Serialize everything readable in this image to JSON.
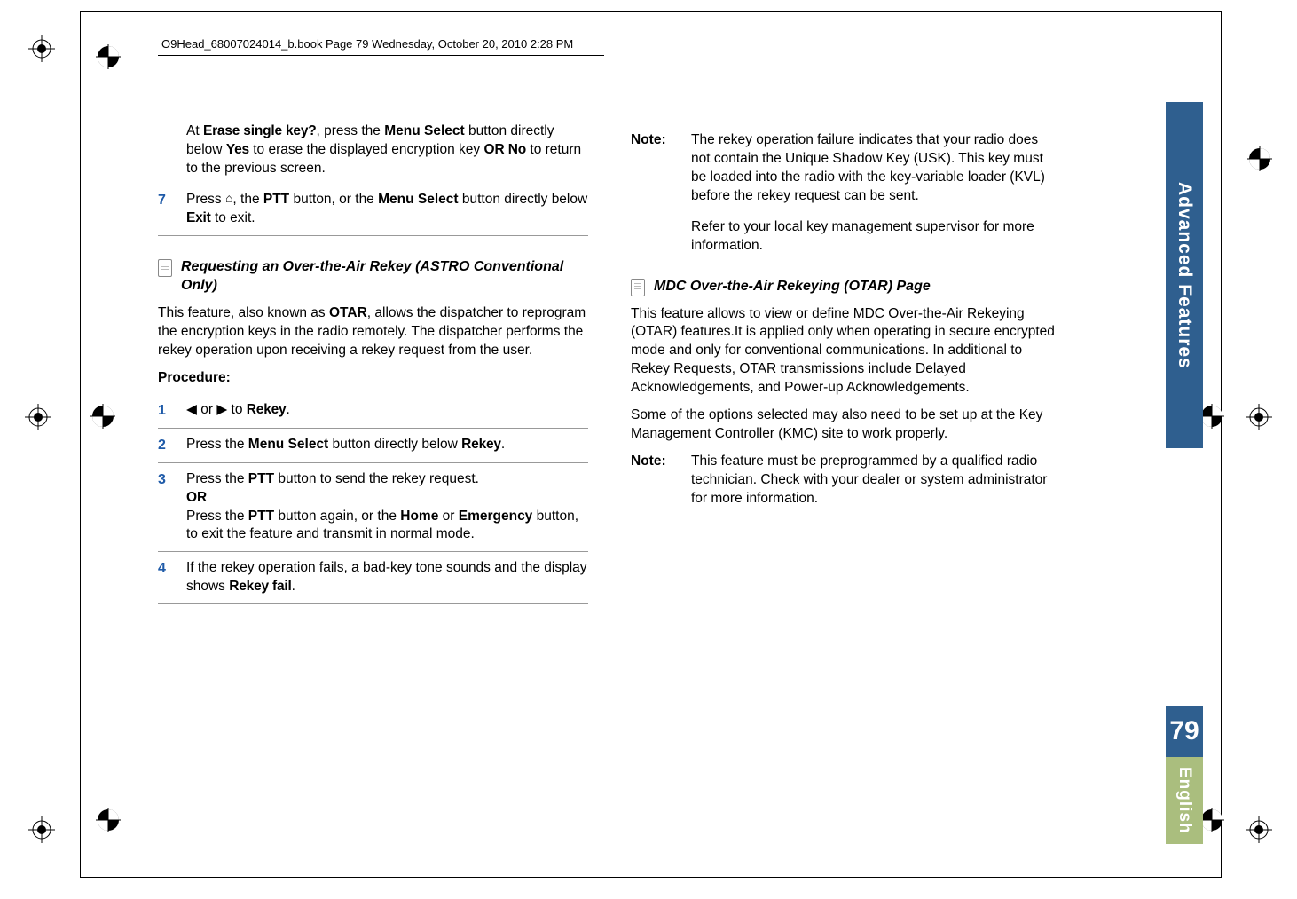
{
  "header": {
    "running": "O9Head_68007024014_b.book  Page 79  Wednesday, October 20, 2010  2:28 PM"
  },
  "left_col": {
    "intro_line1_pre": "At ",
    "intro_line1_code": "Erase single key?",
    "intro_line1_mid": ", press the ",
    "intro_line1_b1": "Menu Select",
    "intro_line1_post": " button directly below ",
    "intro_line1_code2": "Yes",
    "intro_line1_tail": " to erase the displayed encryption key ",
    "intro_or": "OR",
    "intro_no": " No",
    "intro_end": " to return to the previous screen.",
    "step7_num": "7",
    "step7_pre": "Press ",
    "step7_mid": ", the ",
    "step7_b1": "PTT",
    "step7_mid2": " button, or the ",
    "step7_b2": "Menu Select",
    "step7_mid3": " button directly below ",
    "step7_code": "Exit",
    "step7_end": " to exit.",
    "sec1_title": "Requesting an Over-the-Air Rekey (ASTRO Conventional Only)",
    "sec1_p1_a": "This feature, also known as ",
    "sec1_p1_b": "OTAR",
    "sec1_p1_c": ", allows the dispatcher to reprogram the encryption keys in the radio remotely. The dispatcher performs the rekey operation upon receiving a rekey request from the user.",
    "proc_label": "Procedure:",
    "s1_num": "1",
    "s1_a": " or ",
    "s1_b": " to ",
    "s1_code": "Rekey",
    "s1_end": ".",
    "s2_num": "2",
    "s2_a": "Press the ",
    "s2_b": "Menu Select",
    "s2_c": " button directly below ",
    "s2_code": "Rekey",
    "s2_end": ".",
    "s3_num": "3",
    "s3_a": "Press the ",
    "s3_b": "PTT",
    "s3_c": " button to send the rekey request.",
    "s3_or": "OR",
    "s3_d": "Press the ",
    "s3_e": "PTT",
    "s3_f": " button again, or the ",
    "s3_g": "Home",
    "s3_h": " or ",
    "s3_i": "Emergency",
    "s3_j": " button, to exit the feature and transmit in normal mode.",
    "s4_num": "4",
    "s4_a": "If the rekey operation fails, a bad-key tone sounds and the display shows ",
    "s4_code": "Rekey fail",
    "s4_end": "."
  },
  "right_col": {
    "note1_label": "Note:",
    "note1_p1": "The rekey operation failure indicates that your radio does not contain the Unique Shadow Key (USK). This key must be loaded into the radio with the key-variable loader (KVL) before the rekey request can be sent.",
    "note1_p2": "Refer to your local key management supervisor for more information.",
    "sec2_title": "MDC Over-the-Air Rekeying (OTAR) Page",
    "sec2_p1": "This feature allows to view or define MDC Over-the-Air Rekeying (OTAR) features.It is applied only when operating in secure encrypted mode and only for conventional communications. In additional to Rekey Requests, OTAR transmissions include Delayed Acknowledgements, and Power-up Acknowledgements.",
    "sec2_p2": "Some of the options selected may also need to be set up at the Key Management Controller (KMC) site to work properly.",
    "note2_label": "Note:",
    "note2_p1": "This feature must be preprogrammed by a qualified radio technician. Check with your dealer or system administrator for more information."
  },
  "tab": {
    "section": "Advanced Features",
    "page": "79",
    "lang": "English"
  }
}
